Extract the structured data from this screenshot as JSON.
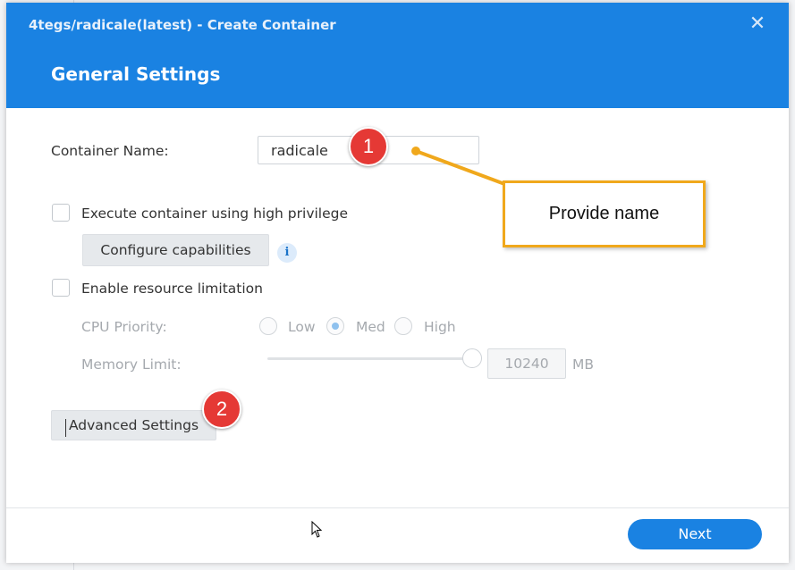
{
  "window": {
    "title": "4tegs/radicale(latest) - Create Container",
    "close_icon": "close-icon"
  },
  "section": {
    "title": "General Settings"
  },
  "container_name": {
    "label": "Container Name:",
    "value": "radicale"
  },
  "high_privilege": {
    "label": "Execute container using high privilege",
    "checked": false
  },
  "configure_capabilities": {
    "label": "Configure capabilities",
    "info_icon": "info-icon",
    "info_glyph": "i"
  },
  "resource_limitation": {
    "label": "Enable resource limitation",
    "checked": false
  },
  "cpu_priority": {
    "label": "CPU Priority:",
    "options": [
      "Low",
      "Med",
      "High"
    ],
    "selected": "Med"
  },
  "memory_limit": {
    "label": "Memory Limit:",
    "value": "10240",
    "unit": "MB",
    "slider_level": 1.0
  },
  "advanced_settings": {
    "label": "Advanced Settings"
  },
  "footer": {
    "next_label": "Next"
  },
  "annotations": {
    "badge_1": "1",
    "badge_2": "2",
    "callout_text": "Provide name"
  },
  "colors": {
    "header_blue": "#1a82e2",
    "badge_red": "#e53935",
    "callout_orange": "#f0a81c"
  }
}
